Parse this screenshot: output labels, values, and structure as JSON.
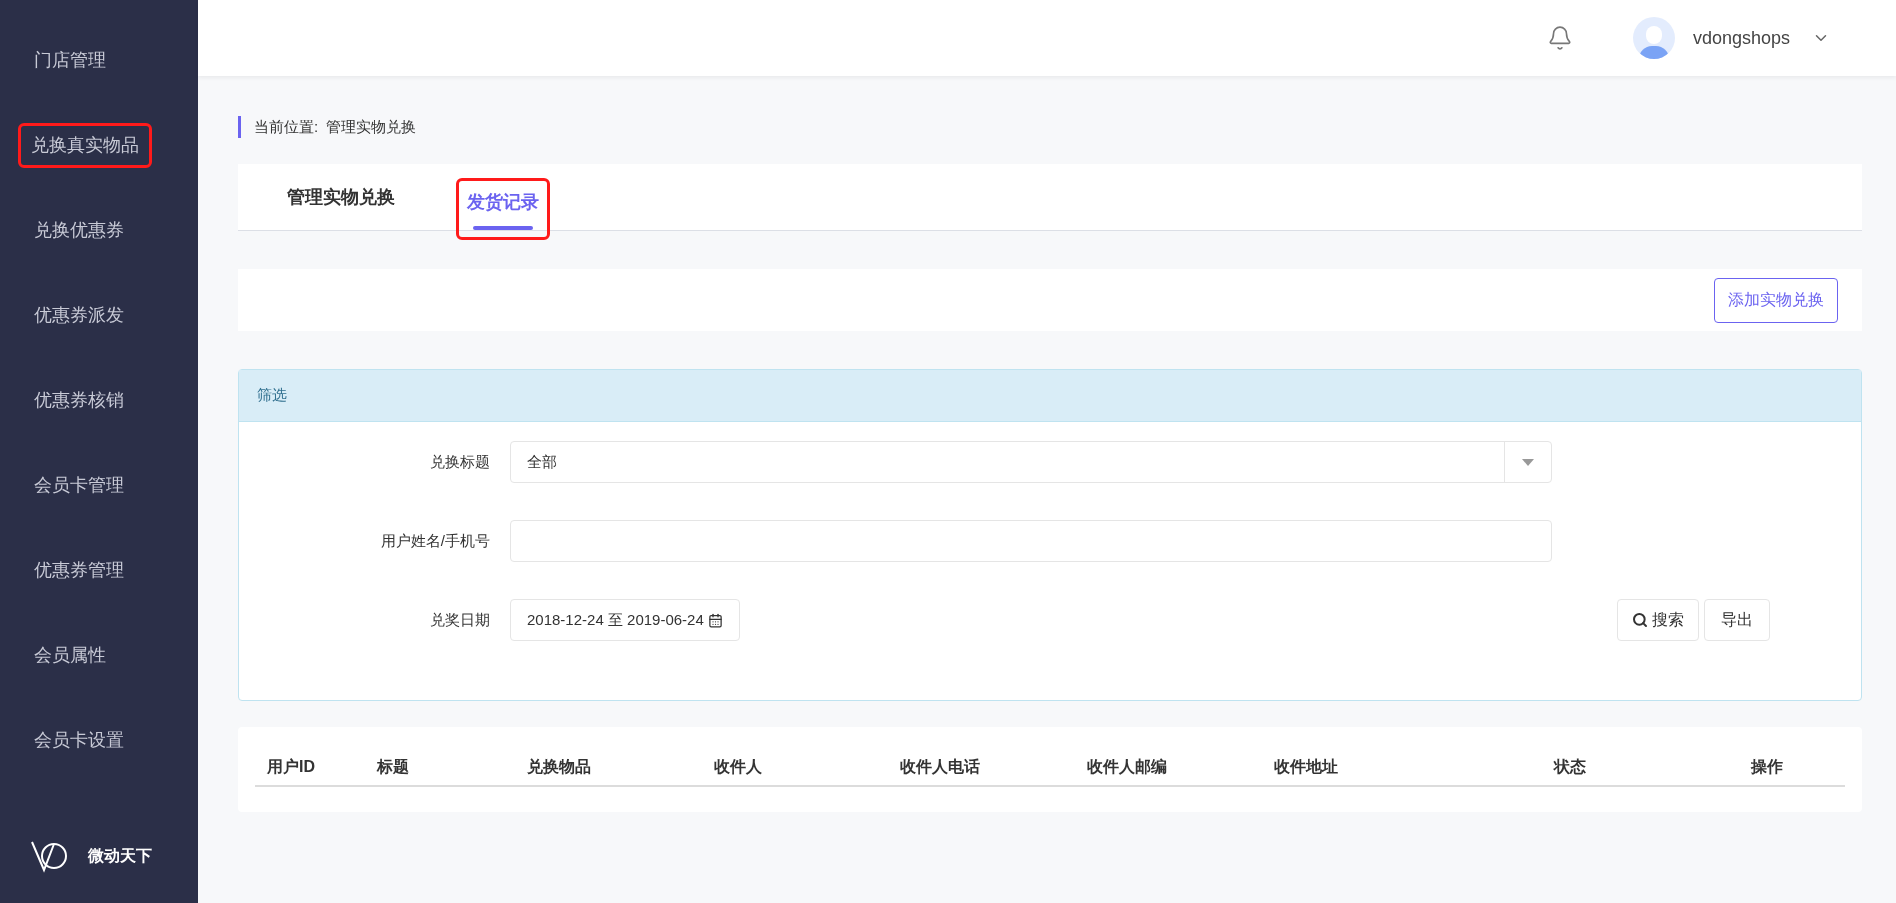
{
  "sidebar": {
    "items": [
      {
        "label": "门店管理",
        "highlighted": false
      },
      {
        "label": "兑换真实物品",
        "highlighted": true
      },
      {
        "label": "兑换优惠券",
        "highlighted": false
      },
      {
        "label": "优惠券派发",
        "highlighted": false
      },
      {
        "label": "优惠券核销",
        "highlighted": false
      },
      {
        "label": "会员卡管理",
        "highlighted": false
      },
      {
        "label": "优惠券管理",
        "highlighted": false
      },
      {
        "label": "会员属性",
        "highlighted": false
      },
      {
        "label": "会员卡设置",
        "highlighted": false
      }
    ],
    "brand": "微动天下"
  },
  "header": {
    "username": "vdongshops"
  },
  "breadcrumb": {
    "label": "当前位置:",
    "current": "管理实物兑换"
  },
  "tabs": [
    {
      "label": "管理实物兑换",
      "selected": false,
      "highlighted": false
    },
    {
      "label": "发货记录",
      "selected": true,
      "highlighted": true
    }
  ],
  "add_button": "添加实物兑换",
  "filter": {
    "title": "筛选",
    "fields": [
      {
        "kind": "select",
        "label": "兑换标题",
        "value": "全部"
      },
      {
        "kind": "text",
        "label": "用户姓名/手机号"
      },
      {
        "kind": "date",
        "label": "兑奖日期",
        "value": "2018-12-24 至 2019-06-24"
      }
    ],
    "search_button": "搜索",
    "export_button": "导出"
  },
  "table": {
    "columns": [
      "用户ID",
      "标题",
      "兑换物品",
      "收件人",
      "收件人电话",
      "收件人邮编",
      "收件地址",
      "状态",
      "操作"
    ]
  }
}
